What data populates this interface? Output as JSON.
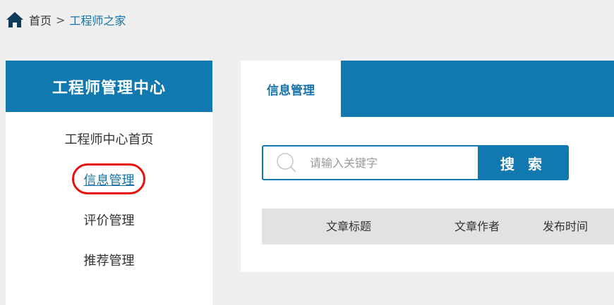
{
  "breadcrumb": {
    "home_label": "首页",
    "separator": ">",
    "current": "工程师之家"
  },
  "sidebar": {
    "title": "工程师管理中心",
    "items": [
      {
        "label": "工程师中心首页",
        "active": false
      },
      {
        "label": "信息管理",
        "active": true
      },
      {
        "label": "评价管理",
        "active": false
      },
      {
        "label": "推荐管理",
        "active": false
      }
    ]
  },
  "main": {
    "tabs": [
      {
        "label": "信息管理",
        "active": true
      }
    ],
    "search": {
      "placeholder": "请输入关键字",
      "value": "",
      "button_label": "搜 索"
    },
    "table": {
      "columns": [
        "文章标题",
        "文章作者",
        "发布时间"
      ]
    }
  },
  "colors": {
    "primary": "#1278b0",
    "link": "#1a73a8",
    "highlight_ring": "#e8100d",
    "page_bg": "#efefef",
    "table_header_bg": "#e2e2e2"
  },
  "icons": {
    "home": "home-icon",
    "search": "search-icon"
  }
}
